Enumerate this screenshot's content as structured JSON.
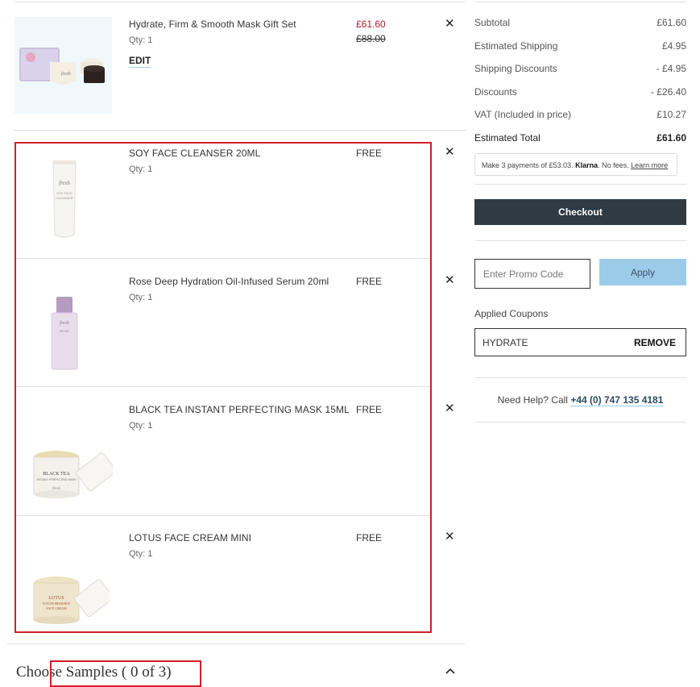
{
  "items": [
    {
      "name": "Hydrate, Firm & Smooth Mask Gift Set",
      "qty": "Qty: 1",
      "price": "£61.60",
      "old_price": "£88.00",
      "edit": "EDIT"
    },
    {
      "name": "SOY FACE CLEANSER 20ML",
      "qty": "Qty: 1",
      "price": "FREE"
    },
    {
      "name": "Rose Deep Hydration Oil-Infused Serum 20ml",
      "qty": "Qty: 1",
      "price": "FREE"
    },
    {
      "name": "BLACK TEA INSTANT PERFECTING MASK 15ML",
      "qty": "Qty: 1",
      "price": "FREE"
    },
    {
      "name": "LOTUS FACE CREAM MINI",
      "qty": "Qty: 1",
      "price": "FREE"
    }
  ],
  "product_art": {
    "soy": [
      "fresh",
      "SOY FACE",
      "CLEANSER"
    ],
    "rose": [
      "fresh",
      "ROSE"
    ],
    "black_tea": [
      "BLACK TEA",
      "INSTANT PERFECTING MASK",
      "fresh"
    ],
    "lotus": [
      "LOTUS",
      "YOUTH PRESERVE",
      "FACE CREAM"
    ],
    "gift": "fresh"
  },
  "samples": {
    "label": "Choose Samples ( 0 of 3)"
  },
  "summary": {
    "rows": [
      {
        "label": "Subtotal",
        "value": "£61.60"
      },
      {
        "label": "Estimated Shipping",
        "value": "£4.95"
      },
      {
        "label": "Shipping Discounts",
        "value": "- £4.95"
      },
      {
        "label": "Discounts",
        "value": "- £26.40"
      },
      {
        "label": "VAT (Included in price)",
        "value": "£10.27"
      }
    ],
    "total_label": "Estimated Total",
    "total_value": "£61.60",
    "klarna_text": "Make 3 payments of £53.03.",
    "klarna_brand": "Klarna",
    "klarna_fees": ". No fees.",
    "klarna_link": "Learn more",
    "checkout": "Checkout",
    "promo_placeholder": "Enter Promo Code",
    "apply": "Apply",
    "applied_label": "Applied Coupons",
    "coupon_code": "HYDRATE",
    "remove": "REMOVE",
    "help_text": "Need Help? Call",
    "help_phone": "+44 (0) 747 135 4181"
  },
  "colors": {
    "sale_price": "#b0182c",
    "checkout_bg": "#2f3a43",
    "apply_bg": "#9ccbea",
    "highlight": "#d11f28"
  }
}
